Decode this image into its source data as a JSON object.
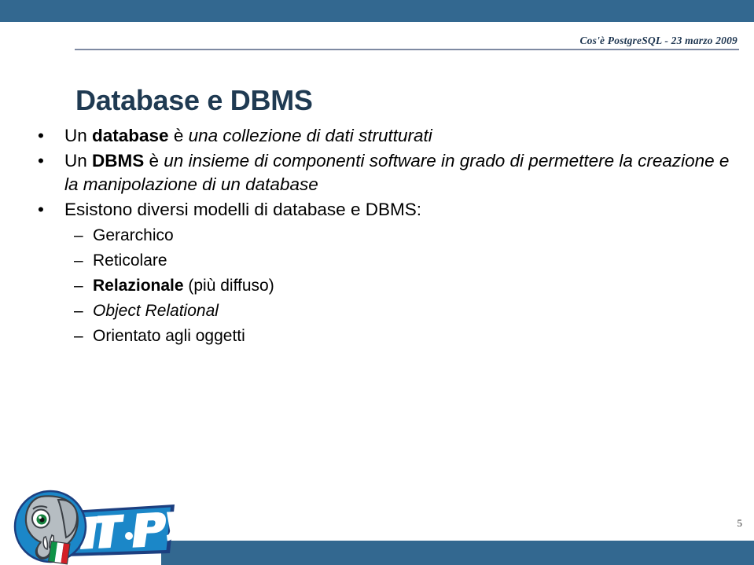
{
  "slide": {
    "header_text": "Cos'è PostgreSQL - 23 marzo 2009",
    "title": "Database e DBMS",
    "page_number": "5",
    "bullet_marker": "•",
    "dash_marker": "–",
    "colors": {
      "bar_blue": "#336890",
      "title_navy": "#1f3a52",
      "rule_gray": "#7e8aa2",
      "header_navy": "#1d3550",
      "body_black": "#000000",
      "logo_blue": "#1b87c8",
      "logo_blue_dark": "#1c3f80",
      "elephant_gray": "#b6bdc2",
      "eye_green": "#16833f",
      "flag_green": "#0f9347",
      "flag_red": "#d32027"
    },
    "bullets": [
      {
        "level": 1,
        "name": "bullet-database",
        "runs": [
          {
            "text": "Un ",
            "style": "normal"
          },
          {
            "text": "database",
            "style": "bold"
          },
          {
            "text": " è ",
            "style": "normal"
          },
          {
            "text": "una collezione di dati strutturati",
            "style": "italic"
          }
        ]
      },
      {
        "level": 1,
        "name": "bullet-dbms",
        "runs": [
          {
            "text": "Un ",
            "style": "normal"
          },
          {
            "text": "DBMS",
            "style": "bold"
          },
          {
            "text": " è ",
            "style": "normal"
          },
          {
            "text": "un insieme di componenti software in grado di permettere la creazione e la manipolazione di un database",
            "style": "italic"
          }
        ]
      },
      {
        "level": 1,
        "name": "bullet-modelli",
        "runs": [
          {
            "text": "Esistono diversi modelli di database e DBMS:",
            "style": "normal"
          }
        ]
      },
      {
        "level": 2,
        "name": "subbullet-gerarchico",
        "runs": [
          {
            "text": "Gerarchico",
            "style": "normal"
          }
        ]
      },
      {
        "level": 2,
        "name": "subbullet-reticolare",
        "runs": [
          {
            "text": "Reticolare",
            "style": "normal"
          }
        ]
      },
      {
        "level": 2,
        "name": "subbullet-relazionale",
        "runs": [
          {
            "text": "Relazionale",
            "style": "bold"
          },
          {
            "text": " (più diffuso)",
            "style": "normal"
          }
        ]
      },
      {
        "level": 2,
        "name": "subbullet-object-relational",
        "runs": [
          {
            "text": "Object Relational",
            "style": "italic"
          }
        ]
      },
      {
        "level": 2,
        "name": "subbullet-orientato-oggetti",
        "runs": [
          {
            "text": "Orientato agli oggetti",
            "style": "normal"
          }
        ]
      }
    ],
    "logo": {
      "name": "itpug-logo",
      "wordmark": "IT·PUG",
      "alt": "ITPUG elephant logo"
    }
  }
}
